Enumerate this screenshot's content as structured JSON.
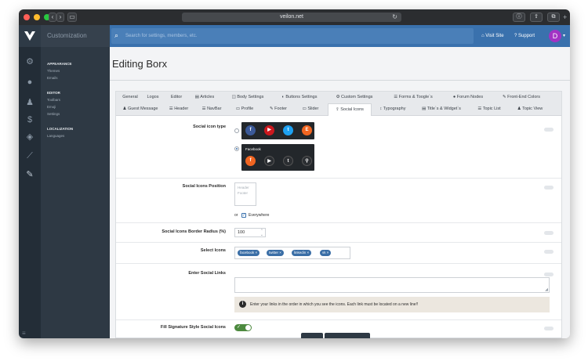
{
  "browser": {
    "url": "veilon.net",
    "tabs_icon": "tabs-icon"
  },
  "topbar": {
    "brand": "Customization",
    "search_placeholder": "Search for settings, members, etc.",
    "visit_site": "Visit Site",
    "support": "Support",
    "avatar_letter": "D"
  },
  "submenu": {
    "sections": [
      {
        "heading": "APPEARANCE",
        "items": [
          "Themes",
          "Emails"
        ]
      },
      {
        "heading": "EDITOR",
        "items": [
          "Toolbars",
          "Emoji",
          "Settings"
        ]
      },
      {
        "heading": "LOCALIZATION",
        "items": [
          "Languages"
        ]
      }
    ]
  },
  "page": {
    "title": "Editing Borx"
  },
  "tabs": {
    "row1": [
      "General",
      "Logos",
      "Editor",
      "Articles",
      "Body Settings",
      "Buttons Settings",
      "Custom Settings",
      "Forms & Toogle`s",
      "Forum Nodes",
      "Front-End Colors"
    ],
    "row2": [
      "Guest Message",
      "Header",
      "NavBar",
      "Profile",
      "Footer",
      "Slider",
      "Social Icons",
      "Typography",
      "Title`s & Widget`s",
      "Topic List",
      "Topic View"
    ],
    "active": "Social Icons"
  },
  "form": {
    "social_icon_type": {
      "label": "Social icon type",
      "option2_caption": "Facebook"
    },
    "position": {
      "label": "Social Icons Position",
      "options": [
        "Header",
        "Footer"
      ],
      "or_text": "or",
      "everywhere": "Everywhere"
    },
    "border_radius": {
      "label": "Social Icons Border Radius (%)",
      "value": "100"
    },
    "select_icons": {
      "label": "Select Icons",
      "tags": [
        "facebook",
        "twitter",
        "linkedin",
        "vk"
      ]
    },
    "social_links": {
      "label": "Enter Social Links",
      "value": "",
      "note": "Enter your links in the order in which you see the icons. Each link must be located on a new line!!"
    },
    "signature_style": {
      "label": "Fill Signature Style Social Icons",
      "enabled": true
    }
  },
  "colors": {
    "topbar": "#3a71ad",
    "facebook": "#3b5998",
    "youtube": "#cc181e",
    "twitter": "#1da1f2",
    "etsy": "#f16521",
    "toggle_on": "#4d8a3f"
  }
}
